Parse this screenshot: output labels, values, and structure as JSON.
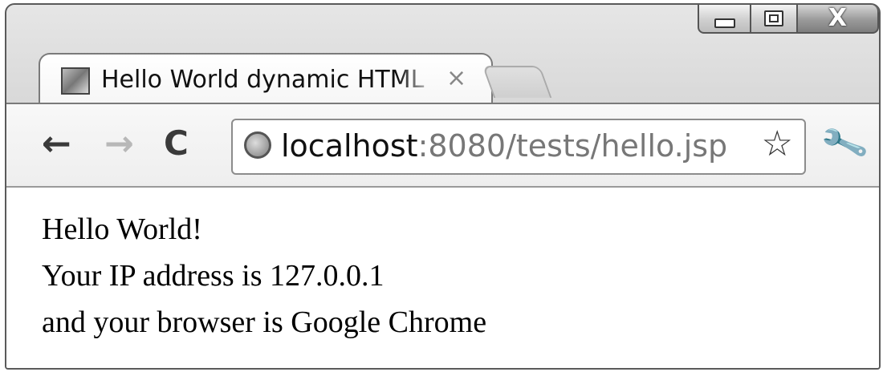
{
  "window": {
    "controls": {
      "minimize_icon": "minimize-icon",
      "maximize_icon": "maximize-icon",
      "close_glyph": "X"
    }
  },
  "tab": {
    "title": "Hello World dynamic HTML",
    "close_glyph": "×",
    "favicon": "page-favicon-icon"
  },
  "toolbar": {
    "back_glyph": "←",
    "forward_glyph": "→",
    "reload_glyph": "C",
    "url_host": "localhost",
    "url_rest": ":8080/tests/hello.jsp",
    "star_glyph": "☆",
    "wrench_glyph": "🔧"
  },
  "content": {
    "line1": "Hello World!",
    "line2": "Your IP address is 127.0.0.1",
    "line3": "and your browser is Google Chrome"
  }
}
